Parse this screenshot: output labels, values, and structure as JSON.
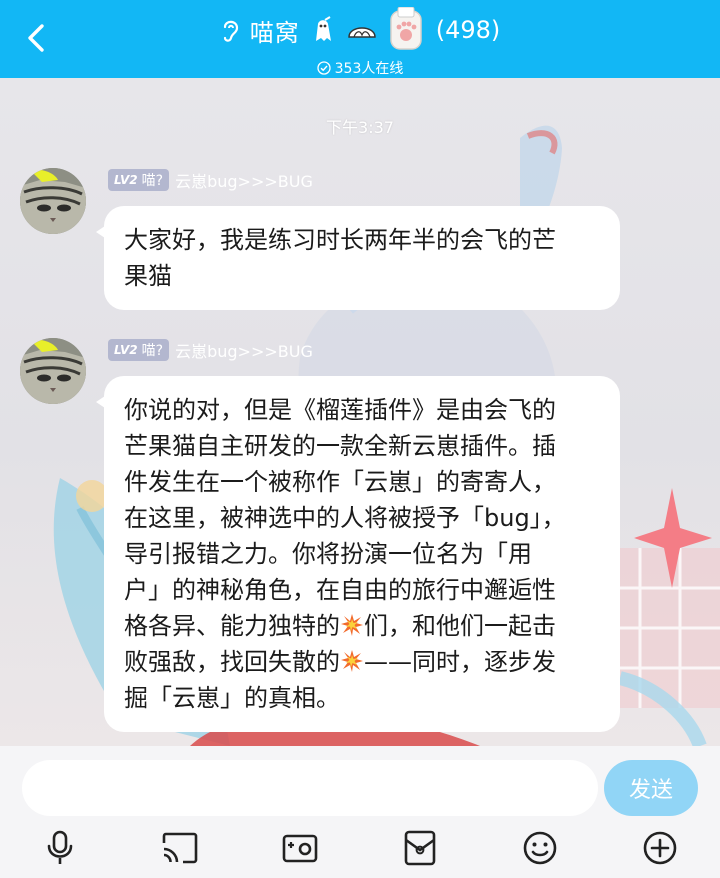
{
  "header": {
    "back_icon": "back-chevron-icon",
    "title": "喵窝",
    "member_count": "(498)",
    "online_text": "353人在线",
    "decor_icons": [
      "ear-icon",
      "ghost-icon",
      "bun-icon",
      "cat-paw-cup-icon"
    ],
    "background_color": "#12b7f5"
  },
  "chat": {
    "timestamp": "下午3:37",
    "messages": [
      {
        "level": "LV2",
        "title_badge": "喵?",
        "sender": "云崽bug>>>BUG",
        "lines": [
          "大家好，我是练习时长两年半的会飞的芒",
          "果猫"
        ]
      },
      {
        "level": "LV2",
        "title_badge": "喵?",
        "sender": "云崽bug>>>BUG",
        "lines": [
          "你说的对，但是《榴莲插件》是由会飞的",
          "芒果猫自主研发的一款全新云崽插件。插",
          "件发生在一个被称作「云崽」的寄寄人，",
          "在这里，被神选中的人将被授予「bug」，",
          "导引报错之力。你将扮演一位名为「用",
          "户」的神秘角色，在自由的旅行中邂逅性"
        ],
        "line7_a": "格各异、能力独特的",
        "line7_b": "们，和他们一起击",
        "line8_a": "败强敌，找回失散的",
        "line8_b": "——同时，逐步发",
        "line9": "掘「云崽」的真相。",
        "emoji": "collision-emoji"
      }
    ]
  },
  "input": {
    "placeholder": "",
    "send_label": "发送",
    "tools": [
      "microphone-icon",
      "screen-cast-icon",
      "photo-icon",
      "red-packet-icon",
      "emoji-icon",
      "plus-icon"
    ]
  }
}
